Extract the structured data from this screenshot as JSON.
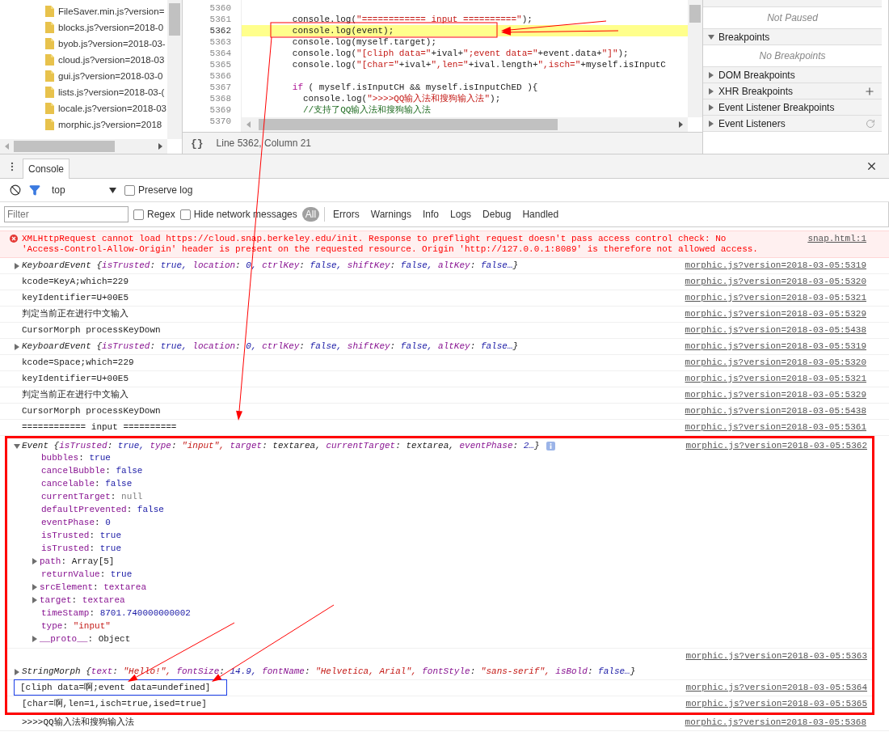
{
  "file_tree": {
    "items": [
      {
        "name": "FileSaver.min.js?version="
      },
      {
        "name": "blocks.js?version=2018-0"
      },
      {
        "name": "byob.js?version=2018-03-"
      },
      {
        "name": "cloud.js?version=2018-03"
      },
      {
        "name": "gui.js?version=2018-03-0"
      },
      {
        "name": "lists.js?version=2018-03-("
      },
      {
        "name": "locale.js?version=2018-03"
      },
      {
        "name": "morphic.js?version=2018"
      }
    ]
  },
  "editor": {
    "lines": [
      {
        "number": "5360",
        "highlighted": false
      },
      {
        "number": "5361",
        "highlighted": false,
        "tokens": [
          {
            "text": "        console.log(",
            "kind": "plain"
          },
          {
            "text": "\"============ input ==========\"",
            "kind": "string"
          },
          {
            "text": ");",
            "kind": "plain"
          }
        ]
      },
      {
        "number": "5362",
        "highlighted": true,
        "tokens": [
          {
            "text": "        console.log(event);",
            "kind": "plain"
          }
        ]
      },
      {
        "number": "5363",
        "highlighted": false,
        "tokens": [
          {
            "text": "        console.log(myself.target);",
            "kind": "plain"
          }
        ]
      },
      {
        "number": "5364",
        "highlighted": false,
        "tokens": [
          {
            "text": "        console.log(",
            "kind": "plain"
          },
          {
            "text": "\"[cliph data=\"",
            "kind": "string"
          },
          {
            "text": "+ival+",
            "kind": "plain"
          },
          {
            "text": "\";event data=\"",
            "kind": "string"
          },
          {
            "text": "+event.data+",
            "kind": "plain"
          },
          {
            "text": "\"]\"",
            "kind": "string"
          },
          {
            "text": ");",
            "kind": "plain"
          }
        ]
      },
      {
        "number": "5365",
        "highlighted": false,
        "tokens": [
          {
            "text": "        console.log(",
            "kind": "plain"
          },
          {
            "text": "\"[char=\"",
            "kind": "string"
          },
          {
            "text": "+ival+",
            "kind": "plain"
          },
          {
            "text": "\",len=\"",
            "kind": "string"
          },
          {
            "text": "+ival.length+",
            "kind": "plain"
          },
          {
            "text": "\",isch=\"",
            "kind": "string"
          },
          {
            "text": "+myself.isInputC",
            "kind": "plain"
          }
        ]
      },
      {
        "number": "5366",
        "highlighted": false
      },
      {
        "number": "5367",
        "highlighted": false,
        "tokens": [
          {
            "text": "        if",
            "kind": "keyword"
          },
          {
            "text": " ( myself.isInputCH && myself.isInputChED ){",
            "kind": "plain"
          }
        ]
      },
      {
        "number": "5368",
        "highlighted": false,
        "tokens": [
          {
            "text": "          console.log(",
            "kind": "plain"
          },
          {
            "text": "\">>>>QQ输入法和搜狗输入法\"",
            "kind": "string"
          },
          {
            "text": ");",
            "kind": "plain"
          }
        ]
      },
      {
        "number": "5369",
        "highlighted": false,
        "tokens": [
          {
            "text": "          //支持了QQ输入法和搜狗输入法",
            "kind": "comment"
          }
        ]
      },
      {
        "number": "5370",
        "highlighted": false
      }
    ],
    "status": {
      "format_label": "{}",
      "position": "Line 5362, Column 21"
    }
  },
  "sidebar": {
    "status": "Not Paused",
    "sections": [
      {
        "title": "Breakpoints",
        "expanded": true,
        "kind": "plain",
        "message": "No Breakpoints"
      },
      {
        "title": "DOM Breakpoints",
        "expanded": false,
        "kind": "plain"
      },
      {
        "title": "XHR Breakpoints",
        "expanded": false,
        "kind": "add"
      },
      {
        "title": "Event Listener Breakpoints",
        "expanded": false,
        "kind": "plain"
      },
      {
        "title": "Event Listeners",
        "expanded": false,
        "kind": "refresh"
      }
    ]
  },
  "drawer": {
    "tabs": [
      {
        "label": "Console",
        "selected": true
      }
    ]
  },
  "console": {
    "context": "top",
    "preserve_log": {
      "label": "Preserve log",
      "checked": false
    },
    "filter": {
      "placeholder": "Filter"
    },
    "regex": {
      "label": "Regex",
      "checked": false
    },
    "hide_network": {
      "label": "Hide network messages",
      "checked": false
    },
    "levels": [
      {
        "label": "All",
        "selected": true
      },
      {
        "label": "Errors",
        "selected": false
      },
      {
        "label": "Warnings",
        "selected": false
      },
      {
        "label": "Info",
        "selected": false
      },
      {
        "label": "Logs",
        "selected": false
      },
      {
        "label": "Debug",
        "selected": false
      },
      {
        "label": "Handled",
        "selected": false
      }
    ],
    "messages": [
      {
        "kind": "error",
        "framed": false,
        "lines": [
          "XMLHttpRequest cannot load https://cloud.snap.berkeley.edu/init. Response to preflight request doesn't pass access control check: No",
          "'Access-Control-Allow-Origin' header is present on the requested resource. Origin 'http://127.0.0.1:8089' is therefore not allowed access."
        ],
        "source": "snap.html:1"
      },
      {
        "kind": "object",
        "framed": false,
        "expanded": false,
        "source": "morphic.js?version=2018-03-05:5319",
        "preview": {
          "name": "KeyboardEvent {",
          "end": "}",
          "fields": [
            {
              "key": "isTrusted:",
              "value": "true,",
              "kind": "value"
            },
            {
              "key": "location:",
              "value": "0,",
              "kind": "value"
            },
            {
              "key": "ctrlKey:",
              "value": "false,",
              "kind": "value"
            },
            {
              "key": "shiftKey:",
              "value": "false,",
              "kind": "value"
            },
            {
              "key": "altKey:",
              "value": "false…",
              "kind": "value"
            }
          ]
        }
      },
      {
        "kind": "log",
        "framed": false,
        "text": "kcode=KeyA;which=229",
        "source": "morphic.js?version=2018-03-05:5320"
      },
      {
        "kind": "log",
        "framed": false,
        "text": "keyIdentifier=U+00E5",
        "source": "morphic.js?version=2018-03-05:5321"
      },
      {
        "kind": "log",
        "framed": false,
        "text": "判定当前正在进行中文输入",
        "source": "morphic.js?version=2018-03-05:5329"
      },
      {
        "kind": "log",
        "framed": false,
        "text": "CursorMorph processKeyDown",
        "source": "morphic.js?version=2018-03-05:5438"
      },
      {
        "kind": "object",
        "framed": false,
        "expanded": false,
        "source": "morphic.js?version=2018-03-05:5319",
        "preview": {
          "name": "KeyboardEvent {",
          "end": "}",
          "fields": [
            {
              "key": "isTrusted:",
              "value": "true,",
              "kind": "value"
            },
            {
              "key": "location:",
              "value": "0,",
              "kind": "value"
            },
            {
              "key": "ctrlKey:",
              "value": "false,",
              "kind": "value"
            },
            {
              "key": "shiftKey:",
              "value": "false,",
              "kind": "value"
            },
            {
              "key": "altKey:",
              "value": "false…",
              "kind": "value"
            }
          ]
        }
      },
      {
        "kind": "log",
        "framed": false,
        "text": "kcode=Space;which=229",
        "source": "morphic.js?version=2018-03-05:5320"
      },
      {
        "kind": "log",
        "framed": false,
        "text": "keyIdentifier=U+00E5",
        "source": "morphic.js?version=2018-03-05:5321"
      },
      {
        "kind": "log",
        "framed": false,
        "text": "判定当前正在进行中文输入",
        "source": "morphic.js?version=2018-03-05:5329"
      },
      {
        "kind": "log",
        "framed": false,
        "text": "CursorMorph processKeyDown",
        "source": "morphic.js?version=2018-03-05:5438"
      },
      {
        "kind": "log",
        "framed": false,
        "text": "============ input ==========",
        "source": "morphic.js?version=2018-03-05:5361"
      },
      {
        "kind": "object",
        "framed": true,
        "expanded": true,
        "source": "morphic.js?version=2018-03-05:5362",
        "preview": {
          "name": "Event {",
          "end": "}",
          "fields": [
            {
              "key": "isTrusted:",
              "value": "true,",
              "kind": "value"
            },
            {
              "key": "type:",
              "value": "\"input\",",
              "kind": "string"
            },
            {
              "key": "target:",
              "value": "textarea,",
              "kind": "object"
            },
            {
              "key": "currentTarget:",
              "value": "textarea,",
              "kind": "object"
            },
            {
              "key": "eventPhase:",
              "value": "2…",
              "kind": "value"
            }
          ]
        },
        "properties": [
          {
            "key": "bubbles:",
            "value": "true",
            "kind": "value",
            "expandable": false
          },
          {
            "key": "cancelBubble:",
            "value": "false",
            "kind": "value",
            "expandable": false
          },
          {
            "key": "cancelable:",
            "value": "false",
            "kind": "value",
            "expandable": false
          },
          {
            "key": "currentTarget:",
            "value": "null",
            "kind": "null",
            "expandable": false
          },
          {
            "key": "defaultPrevented:",
            "value": "false",
            "kind": "value",
            "expandable": false
          },
          {
            "key": "eventPhase:",
            "value": "0",
            "kind": "value",
            "expandable": false
          },
          {
            "key": "isTrusted:",
            "value": "true",
            "kind": "value",
            "expandable": false
          },
          {
            "key": "isTrusted:",
            "value": "true",
            "kind": "value",
            "expandable": false
          },
          {
            "key": "path:",
            "value": "Array[5]",
            "kind": "object",
            "expandable": true
          },
          {
            "key": "returnValue:",
            "value": "true",
            "kind": "value",
            "expandable": false
          },
          {
            "key": "srcElement:",
            "value": "textarea",
            "kind": "node",
            "expandable": true
          },
          {
            "key": "target:",
            "value": "textarea",
            "kind": "node",
            "expandable": true
          },
          {
            "key": "timeStamp:",
            "value": "8701.740000000002",
            "kind": "value",
            "expandable": false
          },
          {
            "key": "type:",
            "value": "\"input\"",
            "kind": "string",
            "expandable": false
          },
          {
            "key": "__proto__:",
            "value": "Object",
            "kind": "object",
            "expandable": true
          }
        ]
      },
      {
        "kind": "object-wrapped",
        "framed": true,
        "expanded": false,
        "source": "morphic.js?version=2018-03-05:5363",
        "preview": {
          "name": "StringMorph {",
          "end": "}",
          "fields": [
            {
              "key": "text:",
              "value": "\"Hello!\",",
              "kind": "string"
            },
            {
              "key": "fontSize:",
              "value": "14.9,",
              "kind": "value"
            },
            {
              "key": "fontName:",
              "value": "\"Helvetica, Arial\",",
              "kind": "string"
            },
            {
              "key": "fontStyle:",
              "value": "\"sans-serif\",",
              "kind": "string"
            },
            {
              "key": "isBold:",
              "value": "false…",
              "kind": "value"
            }
          ]
        }
      },
      {
        "kind": "log",
        "framed": true,
        "boxed": true,
        "text": "[cliph data=啊;event data=undefined]",
        "source": "morphic.js?version=2018-03-05:5364"
      },
      {
        "kind": "log",
        "framed": true,
        "text": "[char=啊,len=1,isch=true,ised=true]",
        "source": "morphic.js?version=2018-03-05:5365"
      },
      {
        "kind": "log",
        "framed": false,
        "text": ">>>>QQ输入法和搜狗输入法",
        "source": "morphic.js?version=2018-03-05:5368"
      }
    ]
  }
}
